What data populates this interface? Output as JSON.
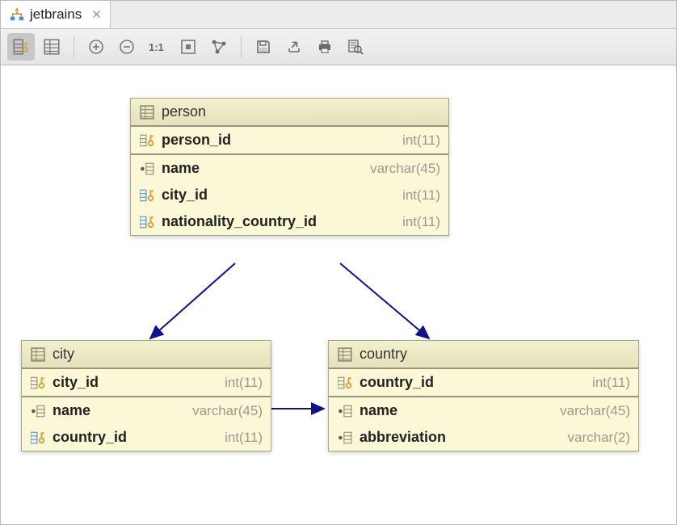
{
  "tab": {
    "label": "jetbrains"
  },
  "toolbar": {
    "buttons": [
      "key-columns-view",
      "table-view",
      "zoom-in",
      "zoom-out",
      "actual-size",
      "fit-content",
      "layout",
      "save",
      "export",
      "print",
      "preview"
    ]
  },
  "entities": {
    "person": {
      "name": "person",
      "columns": [
        {
          "name": "person_id",
          "type": "int(11)",
          "kind": "pk"
        },
        {
          "name": "name",
          "type": "varchar(45)",
          "kind": "col"
        },
        {
          "name": "city_id",
          "type": "int(11)",
          "kind": "fk"
        },
        {
          "name": "nationality_country_id",
          "type": "int(11)",
          "kind": "fk"
        }
      ]
    },
    "city": {
      "name": "city",
      "columns": [
        {
          "name": "city_id",
          "type": "int(11)",
          "kind": "pk"
        },
        {
          "name": "name",
          "type": "varchar(45)",
          "kind": "col"
        },
        {
          "name": "country_id",
          "type": "int(11)",
          "kind": "fk"
        }
      ]
    },
    "country": {
      "name": "country",
      "columns": [
        {
          "name": "country_id",
          "type": "int(11)",
          "kind": "pk"
        },
        {
          "name": "name",
          "type": "varchar(45)",
          "kind": "col"
        },
        {
          "name": "abbreviation",
          "type": "varchar(2)",
          "kind": "col"
        }
      ]
    }
  },
  "relations": [
    {
      "from": "person",
      "to": "city"
    },
    {
      "from": "person",
      "to": "country"
    },
    {
      "from": "city",
      "to": "country"
    }
  ]
}
